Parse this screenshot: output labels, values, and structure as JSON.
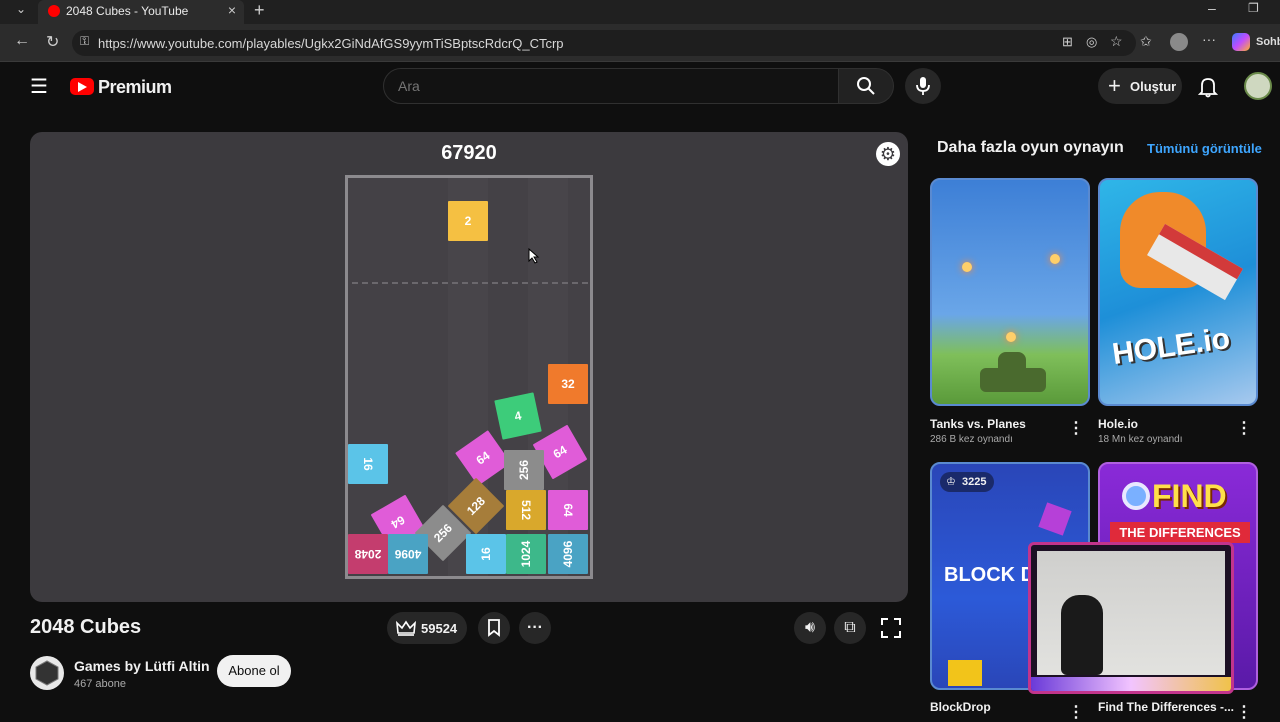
{
  "browser": {
    "tab_title": "2048 Cubes - YouTube",
    "url": "https://www.youtube.com/playables/Ugkx2GiNdAfGS9yymTiSBptscRdcrQ_CTcrp",
    "profile_label": "Sohb"
  },
  "header": {
    "logo_text": "Premium",
    "search_placeholder": "Ara",
    "create_label": "Oluştur"
  },
  "game": {
    "score": "67920",
    "title": "2048 Cubes",
    "crown_score": "59524",
    "board": {
      "next_cube": "2",
      "cubes": [
        {
          "value": "32",
          "color": "#f07a2c",
          "rot": 0
        },
        {
          "value": "4",
          "color": "#3dcc7a",
          "rot": -12
        },
        {
          "value": "64",
          "color": "#e05cd8",
          "rot": -35
        },
        {
          "value": "64",
          "color": "#e05cd8",
          "rot": -30
        },
        {
          "value": "16",
          "color": "#5bc4e8",
          "rot": 90
        },
        {
          "value": "256",
          "color": "#8c8c8c",
          "rot": -90
        },
        {
          "value": "64",
          "color": "#e05cd8",
          "rot": 150
        },
        {
          "value": "128",
          "color": "#a67d3a",
          "rot": -45
        },
        {
          "value": "256",
          "color": "#8c8c8c",
          "rot": -45
        },
        {
          "value": "512",
          "color": "#d9a82c",
          "rot": 90
        },
        {
          "value": "64",
          "color": "#e05cd8",
          "rot": 90
        },
        {
          "value": "2048",
          "color": "#c43d6e",
          "rot": 180
        },
        {
          "value": "4096",
          "color": "#4aa3c4",
          "rot": 180
        },
        {
          "value": "16",
          "color": "#5bc4e8",
          "rot": -90
        },
        {
          "value": "1024",
          "color": "#3db88a",
          "rot": -90
        },
        {
          "value": "4096",
          "color": "#4aa3c4",
          "rot": -90
        }
      ]
    }
  },
  "channel": {
    "name": "Games by Lütfi Altin",
    "subscribers": "467 abone",
    "subscribe_label": "Abone ol"
  },
  "sidebar": {
    "heading": "Daha fazla oyun oynayın",
    "view_all": "Tümünü görüntüle",
    "games": [
      {
        "title": "Tanks vs. Planes",
        "meta": "286 B kez oynandı"
      },
      {
        "title": "Hole.io",
        "meta": "18 Mn kez oynandı",
        "thumb_text": "HOLE.io"
      },
      {
        "title": "BlockDrop",
        "meta": "",
        "badge": "3225",
        "thumb_text": "BLOCK D"
      },
      {
        "title": "Find The Differences -...",
        "meta": "",
        "thumb_text_1": "FIND",
        "thumb_text_2": "THE DIFFERENCES"
      }
    ]
  }
}
